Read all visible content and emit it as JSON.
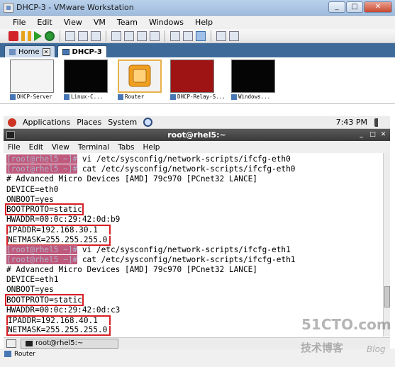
{
  "window": {
    "title": "DHCP-3 - VMware Workstation",
    "minimize": "_",
    "maximize": "□",
    "close": "✕"
  },
  "menubar": [
    "File",
    "Edit",
    "View",
    "VM",
    "Team",
    "Windows",
    "Help"
  ],
  "tabs": [
    {
      "label": "Home"
    },
    {
      "label": "DHCP-3"
    }
  ],
  "thumbnails": [
    {
      "label": "DHCP-Server",
      "screen": "#f4f4f4"
    },
    {
      "label": "Linux-C...",
      "screen": "#050505"
    },
    {
      "label": "Router",
      "screen": "#f2f2f2"
    },
    {
      "label": "DHCP-Relay-S...",
      "screen": "#9e1414"
    },
    {
      "label": "Windows...",
      "screen": "#050505"
    }
  ],
  "gnome_panel": {
    "applications": "Applications",
    "places": "Places",
    "system": "System",
    "clock": "7:43 PM"
  },
  "terminal": {
    "title": "root@rhel5:~",
    "menu": [
      "File",
      "Edit",
      "View",
      "Terminal",
      "Tabs",
      "Help"
    ],
    "prompt": "[root@rhel5 ~]#",
    "lines": [
      {
        "type": "cmd",
        "text": " vi /etc/sysconfig/network-scripts/ifcfg-eth0"
      },
      {
        "type": "cmd",
        "text": " cat /etc/sysconfig/network-scripts/ifcfg-eth0"
      },
      {
        "type": "out",
        "text": "# Advanced Micro Devices [AMD] 79c970 [PCnet32 LANCE]"
      },
      {
        "type": "out",
        "text": "DEVICE=eth0"
      },
      {
        "type": "out",
        "text": "ONBOOT=yes"
      },
      {
        "type": "box",
        "text": "BOOTPROTO=static"
      },
      {
        "type": "out",
        "text": "HWADDR=00:0c:29:42:0d:b9"
      },
      {
        "type": "box2a",
        "text": "IPADDR=192.168.30.1"
      },
      {
        "type": "box2b",
        "text": "NETMASK=255.255.255.0"
      },
      {
        "type": "cmd",
        "text": " vi /etc/sysconfig/network-scripts/ifcfg-eth1"
      },
      {
        "type": "cmd",
        "text": " cat /etc/sysconfig/network-scripts/ifcfg-eth1"
      },
      {
        "type": "out",
        "text": "# Advanced Micro Devices [AMD] 79c970 [PCnet32 LANCE]"
      },
      {
        "type": "out",
        "text": "DEVICE=eth1"
      },
      {
        "type": "out",
        "text": "ONBOOT=yes"
      },
      {
        "type": "box",
        "text": "BOOTPROTO=static"
      },
      {
        "type": "out",
        "text": "HWADDR=00:0c:29:42:0d:c3"
      },
      {
        "type": "box2a",
        "text": "IPADDR=192.168.40.1"
      },
      {
        "type": "box2b",
        "text": "NETMASK=255.255.255.0"
      }
    ]
  },
  "taskbar": {
    "item": "root@rhel5:~"
  },
  "statusbar": {
    "vm": "Router"
  },
  "watermark": {
    "main": "51CTO.com",
    "sub": "技术博客",
    "blog": "Blog"
  }
}
